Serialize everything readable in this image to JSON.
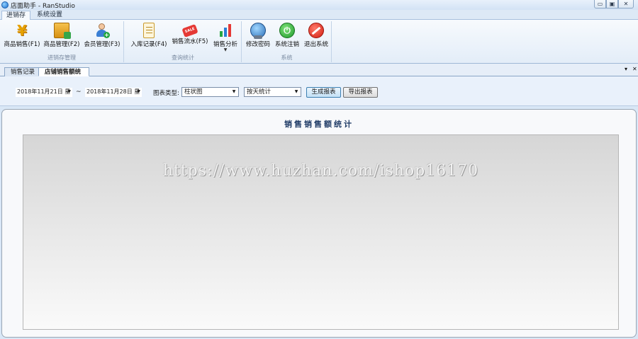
{
  "window": {
    "title": "店面助手 - RanStudio",
    "min_label": "▭",
    "max_label": "▣",
    "close_label": "✕"
  },
  "menu": {
    "tabs": [
      {
        "label": "进销存"
      },
      {
        "label": "系统设置"
      }
    ]
  },
  "ribbon": {
    "groups": [
      {
        "label": "进销存管理"
      },
      {
        "label": "查询统计"
      },
      {
        "label": "系统"
      }
    ],
    "buttons": [
      {
        "label": "商品销售(F1)",
        "icon": "yen-icon"
      },
      {
        "label": "商品管理(F2)",
        "icon": "box-icon"
      },
      {
        "label": "会员管理(F3)",
        "icon": "user-add-icon"
      },
      {
        "label": "入库记录(F4)",
        "icon": "clipboard-icon"
      },
      {
        "label": "销售流水(F5)",
        "icon": "sale-tag-icon"
      },
      {
        "label": "销售分析",
        "icon": "bar-chart-icon"
      },
      {
        "label": "修改密码",
        "icon": "globe-user-icon"
      },
      {
        "label": "系统注销",
        "icon": "power-icon"
      },
      {
        "label": "退出系统",
        "icon": "stop-icon"
      }
    ],
    "tag_text": "SALE"
  },
  "doc_tabs": [
    {
      "label": "销售记录"
    },
    {
      "label": "店铺销售额统计"
    }
  ],
  "filters": {
    "start_date": "2018年11月21日 星",
    "tilde": "~",
    "end_date": "2018年11月28日 星",
    "chart_type_label": "图表类型:",
    "chart_type_value": "柱状图",
    "stat_mode_value": "按天统计",
    "generate_label": "生成报表",
    "export_label": "导出报表"
  },
  "chart_data": {
    "type": "bar",
    "title": "销售销售额统计",
    "categories": [],
    "values": [],
    "watermark": "https://www.huzhan.com/ishop16170"
  },
  "colors": {
    "accent": "#1f3b66",
    "bar_green": "#27a844",
    "bar_blue": "#2b7fd4",
    "bar_red": "#e53935"
  }
}
